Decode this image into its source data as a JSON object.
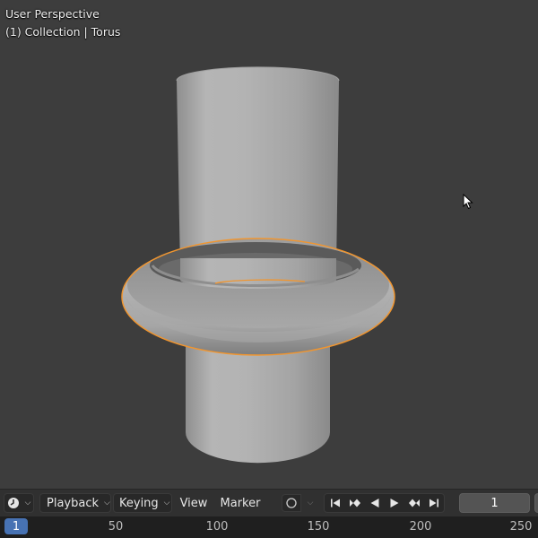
{
  "viewport": {
    "overlay_line1": "User Perspective",
    "overlay_line2": "(1) Collection | Torus",
    "background": "#3d3d3d",
    "selection_outline_color": "#f0952f"
  },
  "timeline": {
    "editor_type_icon": "clock-icon",
    "playback_label": "Playback",
    "keying_label": "Keying",
    "view_label": "View",
    "marker_label": "Marker",
    "autokey_icon": "record-icon",
    "transport_icons": [
      "jump-to-start-icon",
      "jump-to-prev-keyframe-icon",
      "play-reverse-icon",
      "play-icon",
      "jump-to-next-keyframe-icon",
      "jump-to-end-icon"
    ],
    "current_frame": "1",
    "ruler_current": "1",
    "ruler_ticks": [
      "50",
      "100",
      "150",
      "200",
      "250"
    ],
    "accent": "#4772b3"
  }
}
